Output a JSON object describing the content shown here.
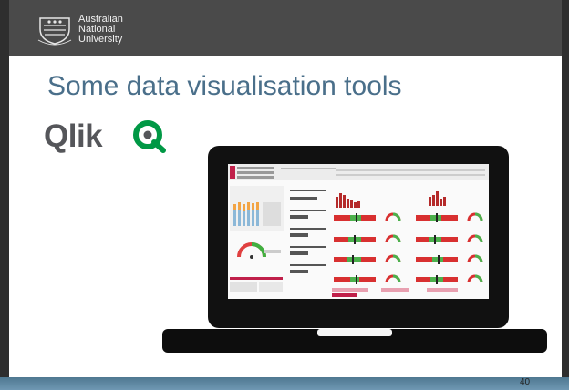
{
  "header": {
    "logo_lines": [
      "Australian",
      "National",
      "University"
    ]
  },
  "slide": {
    "title": "Some data visualisation tools",
    "qlik_logo_text": "Qlik"
  },
  "footer": {
    "page_number": "40"
  },
  "colors": {
    "header_bg": "#4a4a4a",
    "title": "#4a6f8a",
    "qlik_green": "#009845",
    "footer": "#5b83a0"
  }
}
